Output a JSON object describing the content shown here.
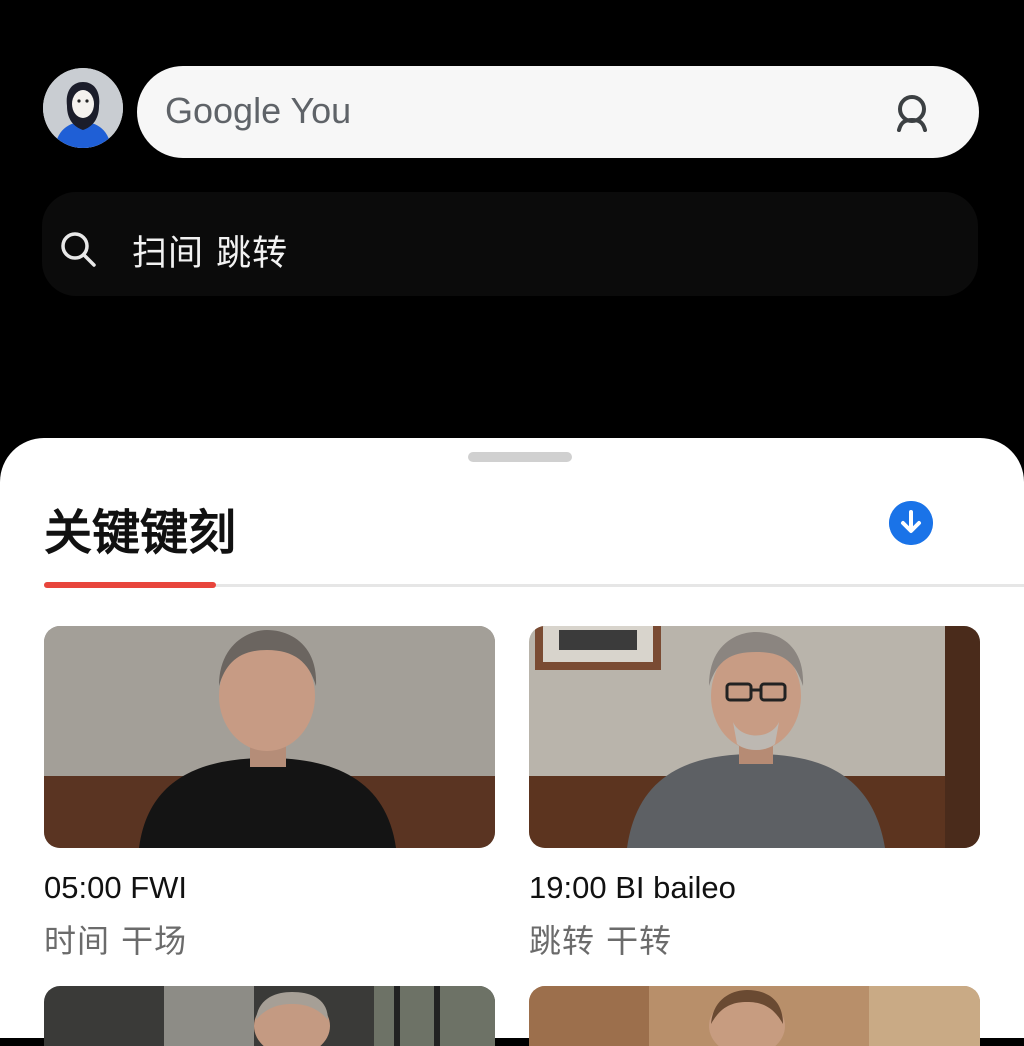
{
  "header": {
    "search_text": "Google You",
    "search_icon": "lens-search-icon",
    "avatar_icon": "user-avatar-icon"
  },
  "secondary_search": {
    "icon": "search-icon",
    "text": "扫间  跳转"
  },
  "sheet": {
    "title": "关键键刻",
    "action_icon": "download-icon",
    "accent_color": "#e8453c",
    "action_color": "#1a73e8"
  },
  "results": [
    {
      "time": "05:00 FWI",
      "subtitle": "时间  干场"
    },
    {
      "time": "19:00 BI  baileo",
      "subtitle": "跳转  干转"
    }
  ]
}
